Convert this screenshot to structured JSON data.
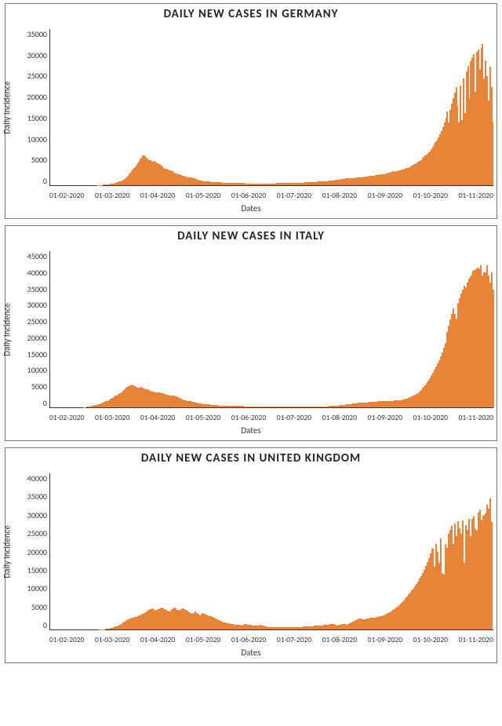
{
  "chart_data": [
    {
      "type": "bar",
      "title": "DAILY NEW CASES IN GERMANY",
      "xlabel": "Dates",
      "ylabel": "Daily Incidence",
      "ylim": [
        0,
        35000
      ],
      "yticks": [
        0,
        5000,
        10000,
        15000,
        20000,
        25000,
        30000,
        35000
      ],
      "categories": [
        "01-02-2020",
        "01-03-2020",
        "01-04-2020",
        "01-05-2020",
        "01-06-2020",
        "01-07-2020",
        "01-08-2020",
        "01-09-2020",
        "01-10-2020",
        "01-11-2020"
      ],
      "values": [
        0,
        0,
        0,
        0,
        0,
        0,
        0,
        0,
        0,
        0,
        0,
        0,
        0,
        0,
        0,
        0,
        0,
        0,
        0,
        0,
        0,
        0,
        0,
        0,
        0,
        0,
        0,
        0,
        0,
        0,
        10,
        20,
        30,
        50,
        80,
        120,
        150,
        180,
        220,
        250,
        300,
        350,
        420,
        500,
        580,
        650,
        800,
        950,
        1100,
        1300,
        1600,
        1900,
        2200,
        2600,
        3000,
        3500,
        3900,
        4300,
        4800,
        5200,
        5800,
        6200,
        6700,
        6700,
        6300,
        5900,
        5600,
        5700,
        5400,
        5300,
        5500,
        5100,
        4900,
        4700,
        4500,
        4200,
        3900,
        3700,
        3700,
        3500,
        3400,
        3300,
        3100,
        2900,
        2700,
        2600,
        2500,
        2500,
        2300,
        2200,
        2100,
        2000,
        1900,
        1800,
        1700,
        1700,
        1600,
        1500,
        1400,
        1300,
        1200,
        1100,
        1000,
        950,
        900,
        850,
        800,
        800,
        780,
        750,
        730,
        700,
        680,
        660,
        640,
        620,
        600,
        590,
        580,
        570,
        560,
        550,
        540,
        530,
        520,
        510,
        500,
        490,
        480,
        470,
        460,
        450,
        440,
        430,
        420,
        420,
        410,
        400,
        400,
        390,
        400,
        400,
        400,
        400,
        400,
        410,
        410,
        420,
        420,
        430,
        430,
        430,
        440,
        450,
        450,
        470,
        450,
        450,
        450,
        460,
        460,
        470,
        480,
        490,
        500,
        520,
        530,
        540,
        560,
        580,
        600,
        610,
        620,
        640,
        660,
        680,
        700,
        720,
        740,
        760,
        780,
        800,
        820,
        850,
        870,
        900,
        930,
        960,
        990,
        1030,
        1070,
        1100,
        1140,
        1180,
        1220,
        1260,
        1300,
        1350,
        1400,
        1450,
        1500,
        1550,
        1600,
        1650,
        1600,
        1600,
        1650,
        1700,
        1700,
        1800,
        1800,
        1800,
        1900,
        1900,
        2000,
        2000,
        2050,
        2100,
        2150,
        2200,
        2250,
        2300,
        2300,
        2400,
        2400,
        2500,
        2500,
        2600,
        2700,
        2800,
        2900,
        3000,
        3100,
        3000,
        3100,
        3200,
        3300,
        3400,
        3500,
        3600,
        3700,
        3800,
        3900,
        4000,
        4200,
        4400,
        4600,
        4800,
        5000,
        5200,
        5400,
        5700,
        6000,
        6300,
        6600,
        6900,
        7200,
        7600,
        8100,
        8600,
        9100,
        9600,
        10100,
        10800,
        11500,
        12200,
        13000,
        14100,
        15200,
        16600,
        14000,
        16900,
        18300,
        19600,
        20800,
        21900,
        17800,
        14000,
        22400,
        14600,
        24000,
        16200,
        25500,
        26800,
        19500,
        27800,
        28600,
        29300,
        21000,
        29900,
        30400,
        26000,
        30800,
        31700,
        24000,
        28000,
        24500,
        19000,
        26500,
        22000,
        14200
      ]
    },
    {
      "type": "bar",
      "title": "DAILY NEW CASES IN ITALY",
      "xlabel": "Dates",
      "ylabel": "Daily Incidence",
      "ylim": [
        0,
        45000
      ],
      "yticks": [
        0,
        5000,
        10000,
        15000,
        20000,
        25000,
        30000,
        35000,
        40000,
        45000
      ],
      "categories": [
        "01-02-2020",
        "01-03-2020",
        "01-04-2020",
        "01-05-2020",
        "01-06-2020",
        "01-07-2020",
        "01-08-2020",
        "01-09-2020",
        "01-10-2020",
        "01-11-2020"
      ],
      "values": [
        0,
        0,
        0,
        0,
        0,
        0,
        0,
        0,
        0,
        0,
        0,
        0,
        0,
        0,
        0,
        0,
        0,
        0,
        0,
        0,
        0,
        50,
        80,
        120,
        180,
        250,
        350,
        470,
        590,
        720,
        850,
        1000,
        1150,
        1300,
        1500,
        1700,
        1900,
        2100,
        2400,
        2700,
        3000,
        3300,
        3500,
        3800,
        4100,
        4400,
        4800,
        5200,
        5600,
        5800,
        6000,
        6300,
        6500,
        6400,
        6200,
        5900,
        5700,
        5600,
        5900,
        5600,
        5500,
        5300,
        5100,
        4900,
        4700,
        4600,
        4500,
        4400,
        4300,
        4200,
        4200,
        4100,
        4000,
        3900,
        3700,
        3600,
        3500,
        3400,
        3400,
        3300,
        3200,
        3100,
        2900,
        2700,
        2500,
        2300,
        2100,
        2000,
        1900,
        1800,
        1700,
        1600,
        1500,
        1400,
        1300,
        1200,
        1100,
        1050,
        1000,
        950,
        900,
        850,
        800,
        750,
        700,
        650,
        620,
        590,
        560,
        540,
        520,
        500,
        490,
        480,
        470,
        460,
        450,
        440,
        430,
        420,
        410,
        400,
        390,
        370,
        350,
        330,
        330,
        330,
        320,
        310,
        300,
        290,
        280,
        280,
        270,
        260,
        250,
        250,
        240,
        240,
        230,
        230,
        220,
        220,
        210,
        210,
        200,
        200,
        200,
        190,
        190,
        190,
        190,
        180,
        180,
        180,
        180,
        180,
        180,
        180,
        180,
        180,
        190,
        190,
        190,
        190,
        190,
        200,
        200,
        210,
        210,
        220,
        230,
        240,
        250,
        260,
        270,
        290,
        310,
        330,
        350,
        380,
        410,
        440,
        470,
        500,
        550,
        600,
        650,
        710,
        770,
        830,
        890,
        950,
        1010,
        1080,
        1150,
        1200,
        1250,
        1300,
        1330,
        1360,
        1390,
        1420,
        1450,
        1480,
        1510,
        1540,
        1580,
        1620,
        1650,
        1680,
        1700,
        1730,
        1770,
        1800,
        1830,
        1870,
        1900,
        1800,
        1800,
        1900,
        1950,
        2000,
        2050,
        2000,
        2100,
        2200,
        2300,
        2400,
        2550,
        2700,
        2900,
        3100,
        3300,
        3550,
        3850,
        4150,
        4500,
        4950,
        5400,
        5900,
        6400,
        7000,
        7700,
        8450,
        9200,
        10000,
        10850,
        11700,
        12600,
        13600,
        14700,
        15900,
        17200,
        18650,
        21800,
        23500,
        25250,
        26850,
        28500,
        27000,
        25500,
        30000,
        31500,
        32700,
        34000,
        35050,
        34500,
        36000,
        37000,
        37850,
        38550,
        39300,
        39600,
        39900,
        40250,
        40000,
        40900,
        38000,
        38900,
        39000,
        41000,
        38000,
        36000,
        39000,
        34000
      ]
    },
    {
      "type": "bar",
      "title": "DAILY NEW CASES IN UNITED KINGDOM",
      "xlabel": "Dates",
      "ylabel": "Daily Incidence",
      "ylim": [
        0,
        40000
      ],
      "yticks": [
        0,
        5000,
        10000,
        15000,
        20000,
        25000,
        30000,
        35000,
        40000
      ],
      "categories": [
        "01-02-2020",
        "01-03-2020",
        "01-04-2020",
        "01-05-2020",
        "01-06-2020",
        "01-07-2020",
        "01-08-2020",
        "01-09-2020",
        "01-10-2020",
        "01-11-2020"
      ],
      "values": [
        0,
        0,
        0,
        0,
        0,
        0,
        0,
        0,
        0,
        0,
        0,
        0,
        0,
        0,
        0,
        0,
        0,
        0,
        0,
        0,
        0,
        0,
        0,
        0,
        0,
        0,
        0,
        0,
        0,
        0,
        20,
        40,
        70,
        100,
        150,
        200,
        280,
        350,
        450,
        600,
        750,
        900,
        1100,
        1300,
        1500,
        1800,
        2100,
        2400,
        2700,
        2900,
        3000,
        3100,
        3200,
        3300,
        3500,
        3700,
        3900,
        4100,
        4300,
        4500,
        4800,
        5100,
        5300,
        5500,
        5200,
        4900,
        5100,
        5300,
        5500,
        5600,
        5400,
        5200,
        5100,
        4900,
        4600,
        5000,
        5300,
        5700,
        5400,
        5100,
        4800,
        5200,
        5500,
        5250,
        5000,
        4750,
        4500,
        4250,
        4000,
        4300,
        4600,
        4300,
        4000,
        3700,
        4000,
        4300,
        4100,
        3900,
        3700,
        3500,
        3400,
        3300,
        3100,
        2900,
        2700,
        2500,
        2300,
        2100,
        1900,
        1800,
        1700,
        1600,
        1500,
        1400,
        1350,
        1300,
        1250,
        1200,
        1150,
        1100,
        1300,
        1500,
        1400,
        1300,
        1200,
        1150,
        1100,
        1050,
        1000,
        950,
        1100,
        1250,
        1100,
        950,
        850,
        750,
        700,
        700,
        700,
        650,
        600,
        550,
        600,
        650,
        700,
        650,
        600,
        560,
        600,
        640,
        680,
        640,
        600,
        620,
        640,
        660,
        680,
        700,
        720,
        740,
        760,
        790,
        820,
        850,
        880,
        910,
        950,
        980,
        1020,
        1060,
        1100,
        1140,
        1180,
        1230,
        1280,
        1330,
        1380,
        1430,
        1260,
        1100,
        1200,
        1300,
        1400,
        1500,
        1350,
        1200,
        1400,
        1600,
        1800,
        2000,
        2200,
        2400,
        2600,
        2800,
        2750,
        2700,
        2600,
        2700,
        2800,
        2900,
        2950,
        3000,
        3000,
        3100,
        3200,
        3300,
        3400,
        3500,
        3600,
        3800,
        4000,
        4200,
        4400,
        4700,
        5000,
        5300,
        5600,
        5900,
        6300,
        6700,
        7100,
        7500,
        8000,
        8500,
        9000,
        9500,
        10000,
        10500,
        11000,
        11600,
        12300,
        13000,
        13700,
        14500,
        15300,
        16200,
        17200,
        18300,
        19500,
        20700,
        16000,
        22000,
        20000,
        17000,
        23300,
        14500,
        14000,
        22000,
        21000,
        24600,
        25600,
        26500,
        22000,
        27200,
        24000,
        27700,
        26000,
        24500,
        28000,
        17000,
        26800,
        25500,
        28300,
        24000,
        28300,
        29000,
        25800,
        25300,
        30000,
        30500,
        28000,
        29200,
        29800,
        32000,
        31000,
        33500,
        27500
      ]
    }
  ]
}
